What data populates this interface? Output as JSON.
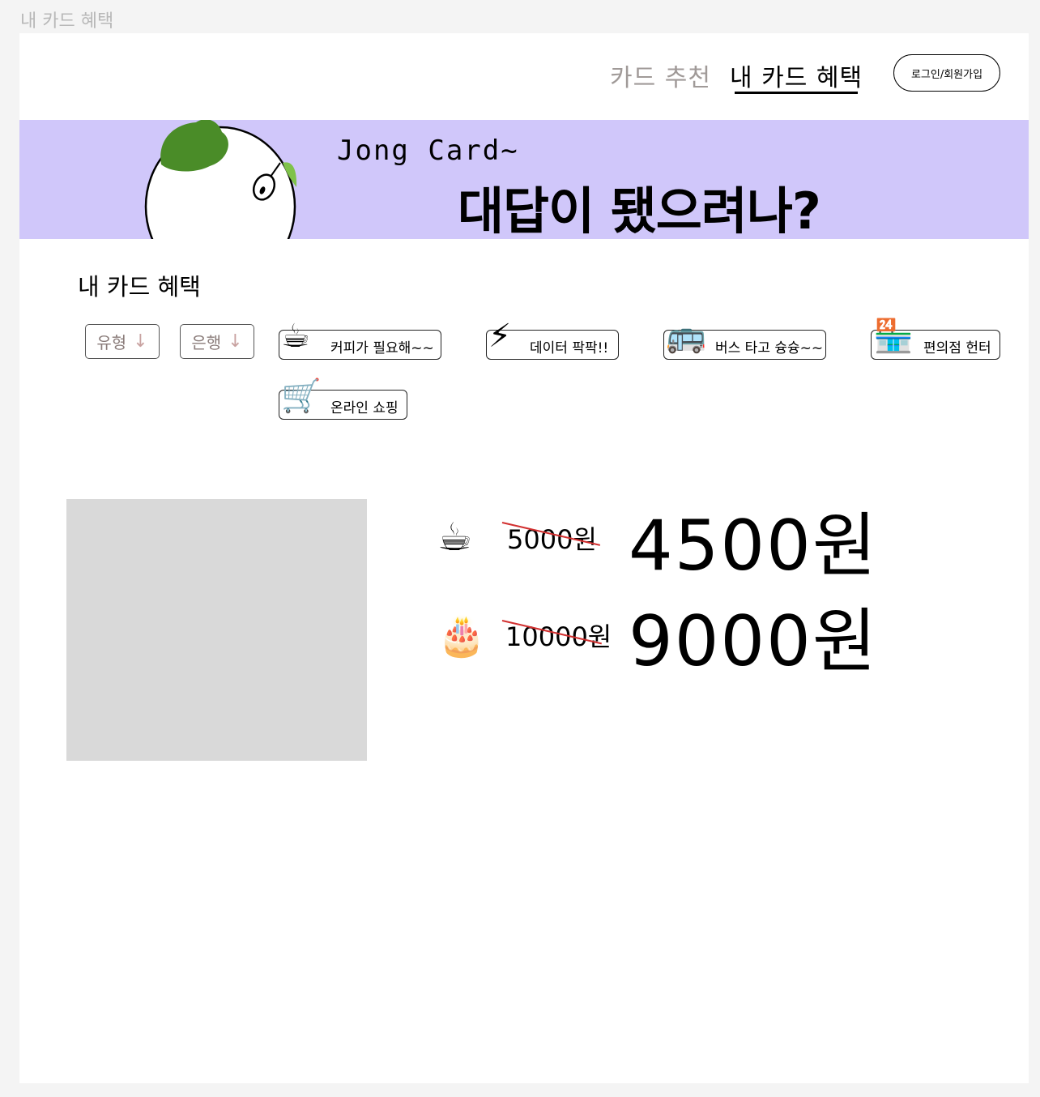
{
  "frame_label": "내 카드 혜택",
  "header": {
    "nav": [
      {
        "label": "카드 추천",
        "active": false
      },
      {
        "label": "내 카드 혜택",
        "active": true
      }
    ],
    "login_label": "로그인/회원가입"
  },
  "banner": {
    "subtitle": "Jong Card~",
    "headline": "대답이 됐으려나?",
    "background": "#d0c7fa"
  },
  "section": {
    "title": "내 카드 혜택",
    "filters": [
      {
        "label": "유형",
        "icon": "arrow-down-icon"
      },
      {
        "label": "은행",
        "icon": "arrow-down-icon"
      }
    ],
    "categories": [
      {
        "icon_char": "☕",
        "icon": "coffee-icon",
        "label": "커피가 필요해~~"
      },
      {
        "icon_char": "⚡",
        "icon": "lightning-icon",
        "label": "데이터 팍팍!!"
      },
      {
        "icon_char": "🚌",
        "icon": "bus-icon",
        "label": "버스 타고 슝슝~~"
      },
      {
        "icon_char": "🏪",
        "icon": "convenience-store-icon",
        "label": "편의점 헌터"
      },
      {
        "icon_char": "🛒",
        "icon": "shopping-cart-icon",
        "label": "온라인 쇼핑"
      }
    ]
  },
  "deals": [
    {
      "icon_char": "☕",
      "icon": "coffee-icon",
      "old_price": "5000원",
      "new_price": "4500원"
    },
    {
      "icon_char": "🎂",
      "icon": "cake-icon",
      "old_price": "10000원",
      "new_price": "9000원"
    }
  ],
  "colors": {
    "accent_strike": "#d23030",
    "placeholder": "#d9d9d9"
  }
}
